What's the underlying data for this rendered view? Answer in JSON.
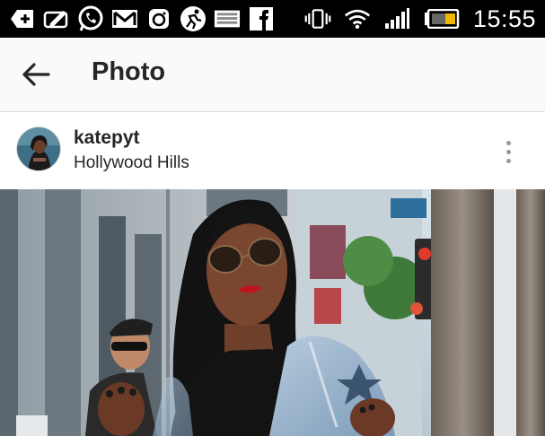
{
  "status_bar": {
    "time": "15:55",
    "notification_icons": [
      "add-icon",
      "edit-icon",
      "whatsapp-icon",
      "gmail-icon",
      "instagram-icon",
      "sports-icon",
      "image-icon",
      "facebook-icon"
    ],
    "system_icons": [
      "vibrate-icon",
      "wifi-icon",
      "signal-icon",
      "battery-icon"
    ]
  },
  "header": {
    "title": "Photo",
    "back_icon": "arrow-left-icon"
  },
  "post": {
    "username": "katepyt",
    "location": "Hollywood Hills",
    "more_icon": "more-vertical-icon"
  },
  "colors": {
    "status_bar_bg": "#000000",
    "header_bg": "#fafafa",
    "text_primary": "#262626"
  }
}
